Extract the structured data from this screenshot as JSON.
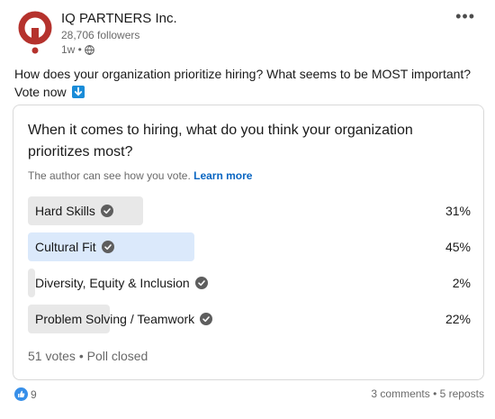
{
  "post": {
    "company": "IQ PARTNERS Inc.",
    "followers": "28,706 followers",
    "time": "1w •",
    "text": "How does your organization prioritize hiring? What seems to be MOST important? Vote now"
  },
  "poll": {
    "question": "When it comes to hiring, what do you think your organization prioritizes most?",
    "note": "The author can see how you vote.",
    "learn_more": "Learn more",
    "options": [
      {
        "label": "Hard Skills",
        "percent": "31%",
        "value": 31,
        "selected": false
      },
      {
        "label": "Cultural Fit",
        "percent": "45%",
        "value": 45,
        "selected": true
      },
      {
        "label": "Diversity, Equity & Inclusion",
        "percent": "2%",
        "value": 2,
        "selected": false
      },
      {
        "label": "Problem Solving / Teamwork",
        "percent": "22%",
        "value": 22,
        "selected": false
      }
    ],
    "footer": "51 votes • Poll closed"
  },
  "social": {
    "likes": "9",
    "counts": "3 comments • 5 reposts"
  },
  "colors": {
    "brand_red": "#b5322d",
    "link_blue": "#0a66c2",
    "selected_bar": "#dbe9fb",
    "bar": "#e8e8e8"
  }
}
